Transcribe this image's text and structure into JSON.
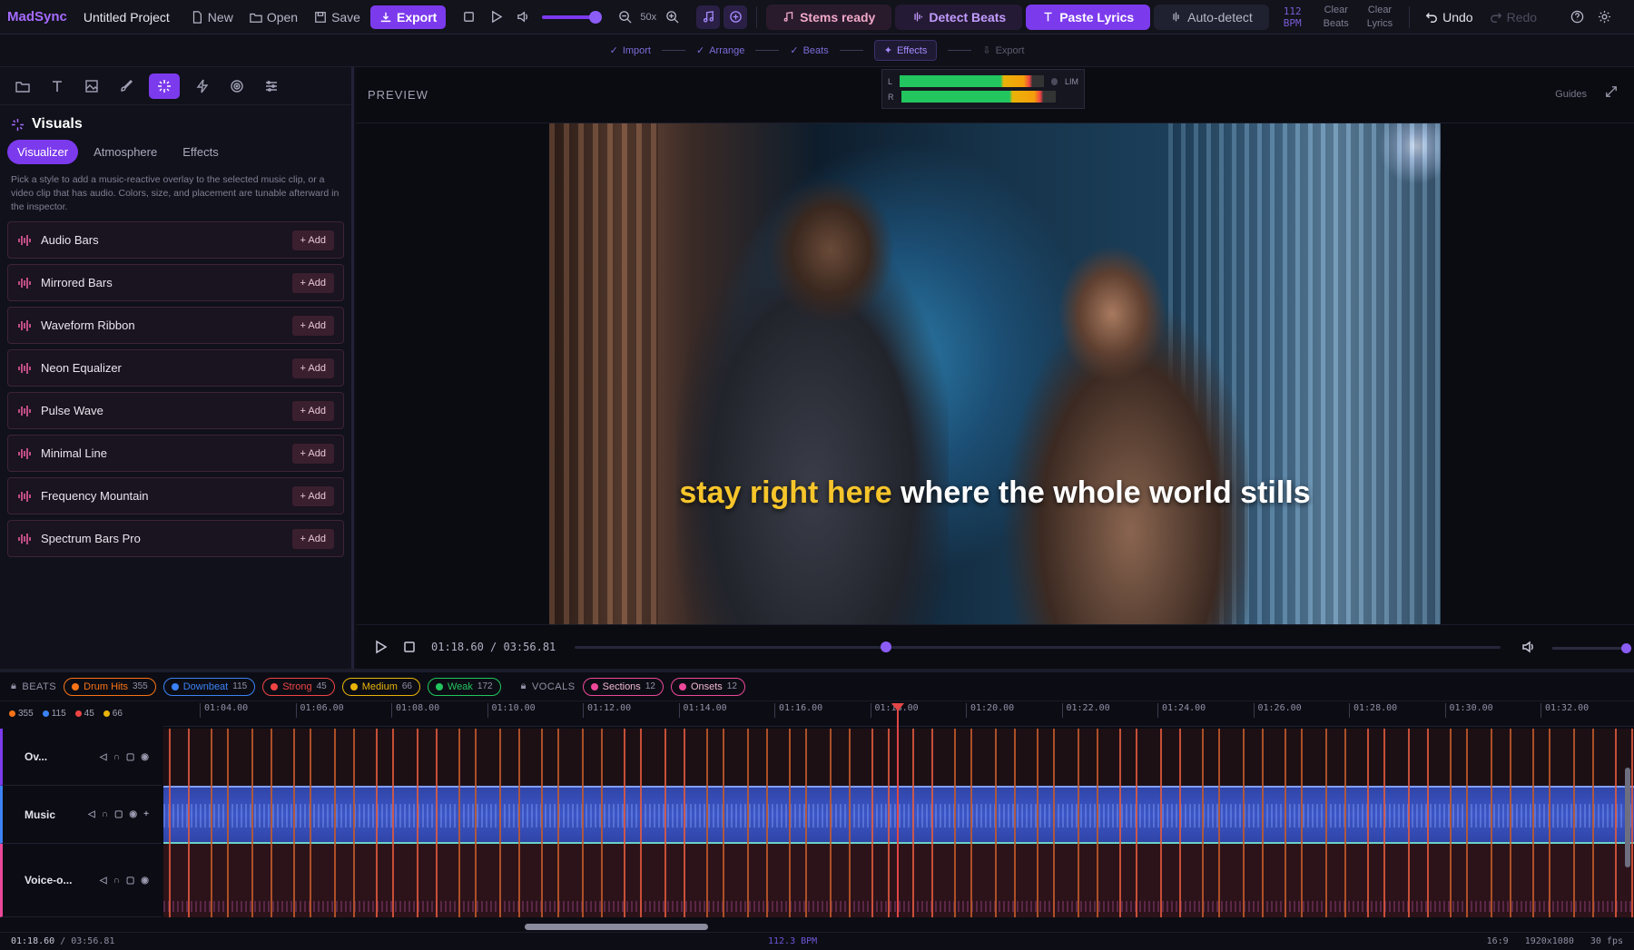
{
  "app": {
    "name": "MadSync",
    "project": "Untitled Project"
  },
  "toolbar": {
    "new_label": "New",
    "open_label": "Open",
    "save_label": "Save",
    "export_label": "Export",
    "zoom_label": "50x",
    "stems_label": "Stems ready",
    "detect_label": "Detect Beats",
    "paste_label": "Paste Lyrics",
    "auto_label": "Auto-detect",
    "bpm_value": "112",
    "bpm_unit": "BPM",
    "clear_beats": [
      "Clear",
      "Beats"
    ],
    "clear_lyrics": [
      "Clear",
      "Lyrics"
    ],
    "undo_label": "Undo",
    "redo_label": "Redo",
    "volume_level": 0.8
  },
  "steps": [
    {
      "label": "Import",
      "state": "done"
    },
    {
      "label": "Arrange",
      "state": "done"
    },
    {
      "label": "Beats",
      "state": "done"
    },
    {
      "label": "Effects",
      "state": "active"
    },
    {
      "label": "Export",
      "state": "off"
    }
  ],
  "sidebar": {
    "title": "Visuals",
    "tabs": [
      "Visualizer",
      "Atmosphere",
      "Effects"
    ],
    "selected_tab": "Visualizer",
    "description": "Pick a style to add a music-reactive overlay to the selected music clip, or a video clip that has audio. Colors, size, and placement are tunable afterward in the inspector.",
    "add_label": "Add",
    "items": [
      "Audio Bars",
      "Mirrored Bars",
      "Waveform Ribbon",
      "Neon Equalizer",
      "Pulse Wave",
      "Minimal Line",
      "Frequency Mountain",
      "Spectrum Bars Pro"
    ]
  },
  "preview": {
    "title": "PREVIEW",
    "guides_label": "Guides",
    "meter_labels": [
      "L",
      "R"
    ],
    "meter_lim": "LIM",
    "subtitle_highlight": "stay right here",
    "subtitle_rest": "where the whole world stills",
    "current_time": "01:18.60",
    "total_time": "03:56.81",
    "progress": 0.33
  },
  "timeline": {
    "beats_label": "BEATS",
    "vocals_label": "VOCALS",
    "chips": [
      {
        "label": "Drum Hits",
        "count": "355",
        "color": "#f97316"
      },
      {
        "label": "Downbeat",
        "count": "115",
        "color": "#3b82f6"
      },
      {
        "label": "Strong",
        "count": "45",
        "color": "#ef4444"
      },
      {
        "label": "Medium",
        "count": "66",
        "color": "#eab308"
      },
      {
        "label": "Weak",
        "count": "172",
        "color": "#22c55e"
      }
    ],
    "vocal_chips": [
      {
        "label": "Sections",
        "count": "12",
        "color": "#ec4899"
      },
      {
        "label": "Onsets",
        "count": "12",
        "color": "#ec4899"
      }
    ],
    "counts": [
      {
        "value": "355",
        "color": "#f97316"
      },
      {
        "value": "115",
        "color": "#3b82f6"
      },
      {
        "value": "45",
        "color": "#ef4444"
      },
      {
        "value": "66",
        "color": "#eab308"
      }
    ],
    "ruler": [
      "01:04.00",
      "01:06.00",
      "01:08.00",
      "01:10.00",
      "01:12.00",
      "01:14.00",
      "01:16.00",
      "01:18.00",
      "01:20.00",
      "01:22.00",
      "01:24.00",
      "01:26.00",
      "01:28.00",
      "01:30.00",
      "01:32.00"
    ],
    "tracks": [
      "Ov...",
      "Music",
      "Voice-o..."
    ]
  },
  "status": {
    "time": "01:18.60",
    "total": "03:56.81",
    "bpm": "112.3 BPM",
    "aspect": "16:9",
    "resolution": "1920x1080",
    "fps": "30 fps"
  }
}
